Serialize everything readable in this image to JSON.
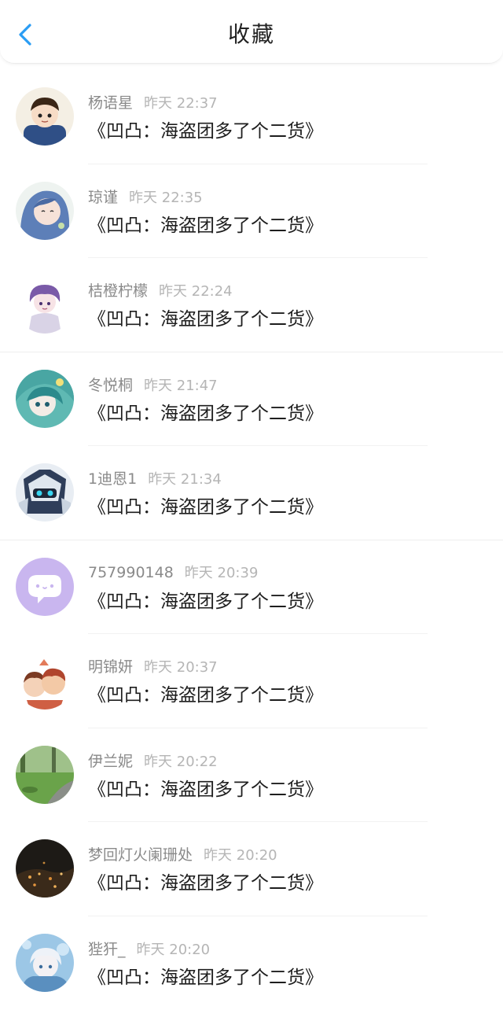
{
  "header": {
    "title": "收藏",
    "back_icon": "chevron-left-icon",
    "accent_color": "#2a9df4"
  },
  "items": [
    {
      "name": "杨语星",
      "time": "昨天 22:37",
      "message": "《凹凸：海盗团多了个二货》",
      "avatar": "anime-boy-avatar"
    },
    {
      "name": "琼谨",
      "time": "昨天 22:35",
      "message": "《凹凸：海盗团多了个二货》",
      "avatar": "anime-girl-avatar"
    },
    {
      "name": "桔橙柠檬",
      "time": "昨天 22:24",
      "message": "《凹凸：海盗团多了个二货》",
      "avatar": "anime-purple-hair-avatar"
    },
    {
      "name": "冬悦桐",
      "time": "昨天 21:47",
      "message": "《凹凸：海盗团多了个二货》",
      "avatar": "anime-teal-hair-avatar"
    },
    {
      "name": "1迪恩1",
      "time": "昨天 21:34",
      "message": "《凹凸：海盗团多了个二货》",
      "avatar": "robot-avatar"
    },
    {
      "name": "757990148",
      "time": "昨天 20:39",
      "message": "《凹凸：海盗团多了个二货》",
      "avatar": "default-chat-bubble-avatar"
    },
    {
      "name": "明锦妍",
      "time": "昨天 20:37",
      "message": "《凹凸：海盗团多了个二货》",
      "avatar": "chibi-group-avatar"
    },
    {
      "name": "伊兰妮",
      "time": "昨天 20:22",
      "message": "《凹凸：海盗团多了个二货》",
      "avatar": "park-landscape-avatar"
    },
    {
      "name": "梦回灯火阑珊处",
      "time": "昨天 20:20",
      "message": "《凹凸：海盗团多了个二货》",
      "avatar": "night-city-avatar"
    },
    {
      "name": "狴犴_",
      "time": "昨天 20:20",
      "message": "《凹凸：海盗团多了个二货》",
      "avatar": "anime-white-hair-avatar"
    }
  ]
}
